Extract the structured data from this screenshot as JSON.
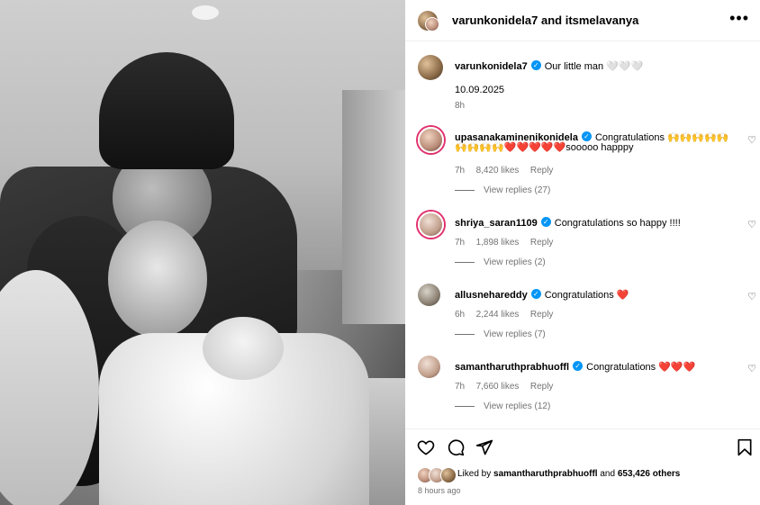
{
  "header": {
    "usernames": "varunkonidela7 and itsmelavanya",
    "more": "•••"
  },
  "caption": {
    "username": "varunkonidela7",
    "text": "Our little man 🤍🤍🤍",
    "date": "10.09.2025",
    "time": "8h"
  },
  "comments": [
    {
      "username": "upasanakaminenikonidela",
      "text_line1": "Congratulations 🙌🙌🙌🙌🙌",
      "text_line2": "🙌🙌🙌🙌❤️❤️❤️❤️❤️sooooo happpy",
      "time": "7h",
      "likes": "8,420 likes",
      "reply": "Reply",
      "view_replies": "View replies (27)"
    },
    {
      "username": "shriya_saran1109",
      "text_line1": "Congratulations so happy !!!!",
      "time": "7h",
      "likes": "1,898 likes",
      "reply": "Reply",
      "view_replies": "View replies (2)"
    },
    {
      "username": "allusnehareddy",
      "text_line1": "Congratulations ❤️",
      "time": "6h",
      "likes": "2,244 likes",
      "reply": "Reply",
      "view_replies": "View replies (7)"
    },
    {
      "username": "samantharuthprabhuoffl",
      "text_line1": "Congratulations ❤️❤️❤️",
      "time": "7h",
      "likes": "7,660 likes",
      "reply": "Reply",
      "view_replies": "View replies (12)"
    }
  ],
  "likes": {
    "text_prefix": "Liked by",
    "user": "samantharuthprabhuoffl",
    "text_mid": "and",
    "count": "653,426 others"
  },
  "post_time": "8 hours ago",
  "icons": {
    "like": "heart-outline-icon",
    "comment": "comment-icon",
    "share": "paper-plane-icon",
    "save": "bookmark-icon",
    "verified": "verified-badge-icon"
  },
  "colors": {
    "verified": "#0095f6",
    "meta": "#737373",
    "story_ring": "#e1306c"
  }
}
